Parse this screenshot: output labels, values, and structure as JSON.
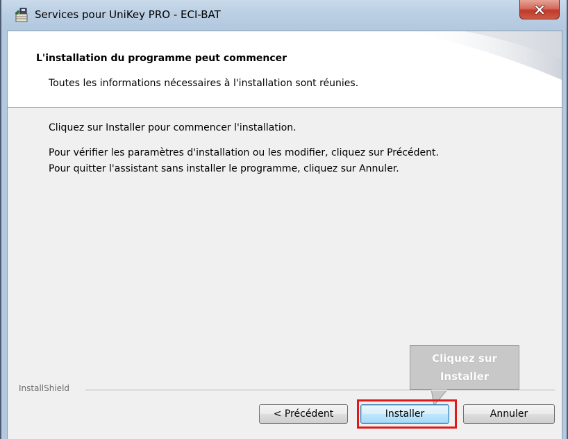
{
  "window": {
    "title": "Services pour UniKey PRO - ECI-BAT",
    "app_icon": "installer-icon",
    "close_icon": "close-icon"
  },
  "header": {
    "title": "L'installation du programme peut commencer",
    "subtitle": "Toutes les informations nécessaires à l'installation sont réunies."
  },
  "body": {
    "paragraphs": [
      "Cliquez sur Installer pour commencer l'installation.",
      "Pour vérifier les paramètres d'installation ou les modifier, cliquez sur Précédent.",
      "Pour quitter l'assistant sans installer le programme, cliquez sur Annuler."
    ]
  },
  "footer": {
    "brand": "InstallShield",
    "buttons": {
      "back": "< Précédent",
      "install": "Installer",
      "cancel": "Annuler"
    }
  },
  "annotation": {
    "callout_lines": [
      "Cliquez sur",
      "Installer"
    ],
    "highlight_color": "#e01818"
  },
  "colors": {
    "title_bar": "#bcd0e4",
    "close_button": "#c0392b",
    "dialog_background": "#f0f0f0",
    "callout_background": "#c8c8c8"
  }
}
